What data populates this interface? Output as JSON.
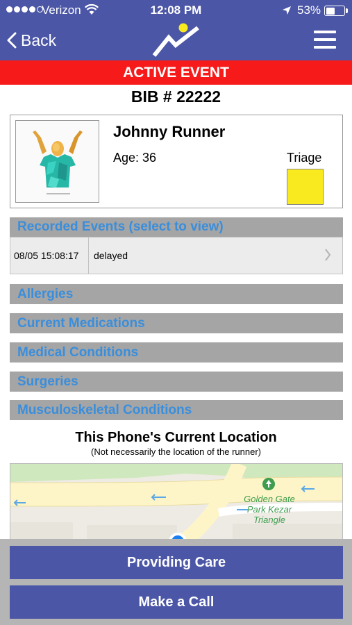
{
  "status_bar": {
    "carrier": "Verizon",
    "time": "12:08 PM",
    "battery": "53%",
    "battery_level": 0.53,
    "signal_dots_filled": 4,
    "signal_dots_total": 5
  },
  "nav": {
    "back_label": "Back",
    "logo_icon": "runner-graph-logo",
    "menu_icon": "hamburger-menu-icon"
  },
  "banner": "ACTIVE EVENT",
  "bib": "BIB # 22222",
  "runner": {
    "name": "Johnny Runner",
    "age": "Age: 36",
    "triage_label": "Triage",
    "triage_color": "#f8ea1e"
  },
  "recorded_events": {
    "header": "Recorded Events (select to view)",
    "items": [
      {
        "time": "08/05 15:08:17",
        "description": "delayed"
      }
    ]
  },
  "categories": [
    "Allergies",
    "Current Medications",
    "Medical Conditions",
    "Surgeries",
    "Musculoskeletal Conditions"
  ],
  "location": {
    "title": "This Phone's Current Location",
    "subtitle": "(Not necessarily the location of the runner)",
    "map_label_line1": "Golden Gate",
    "map_label_line2": "Park Kezar",
    "map_label_line3": "Triangle"
  },
  "actions": {
    "providing_care": "Providing Care",
    "make_call": "Make a Call"
  },
  "colors": {
    "brand": "#4b56a6",
    "alert": "#f61a1a",
    "section_bar": "#a5a5a5",
    "section_text": "#3a8edc"
  }
}
